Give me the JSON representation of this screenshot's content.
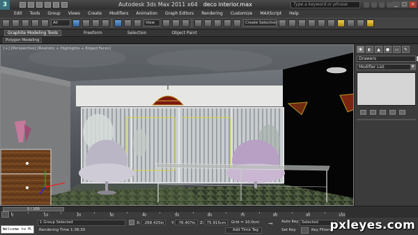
{
  "titlebar": {
    "app": "Autodesk 3ds Max  2011 x64",
    "file": "deco interior.max",
    "search_placeholder": "Type a keyword or phrase"
  },
  "menu": [
    "Edit",
    "Tools",
    "Group",
    "Views",
    "Create",
    "Modifiers",
    "Animation",
    "Graph Editors",
    "Rendering",
    "Customize",
    "MAXScript",
    "Help"
  ],
  "toolbar": {
    "filter_value": "All",
    "view_value": "View",
    "selection_set_value": "Create Selection Se"
  },
  "ribbon": {
    "tabs": [
      "Graphite Modeling Tools",
      "Freeform",
      "Selection",
      "Object Paint"
    ],
    "subtab": "Polygon Modeling"
  },
  "viewport": {
    "label": "[+] [Perspective] [Realistic + Highlights + Edged Faces]"
  },
  "command_panel": {
    "object_name": "Drawers",
    "modifier_list": "Modifier List"
  },
  "timeline": {
    "slider_label": "0 / 100",
    "ticks": [
      "0",
      "10",
      "20",
      "30",
      "40",
      "50",
      "60",
      "70",
      "80",
      "90",
      "100"
    ]
  },
  "status": {
    "maxscript_text": "Welcome to M.",
    "selection": "1 Group Selected",
    "render_time": "Rendering Time  1:38:30",
    "x_label": "X:",
    "x_value": "-268.425in",
    "y_label": "Y:",
    "y_value": "-76.407in",
    "z_label": "Z:",
    "z_value": "75.915cm",
    "grid": "Grid = 10.0cm",
    "add_time_tag": "Add Time Tag",
    "auto_key": "Auto Key",
    "set_key": "Set Key",
    "selected_dd": "Selected",
    "key_filters": "Key Filters..."
  },
  "watermark": "pxleyes.com",
  "colors": {
    "wall_dark": "#0a0a0a",
    "floor": "#3f4a3a",
    "chair": "#b9b4c4",
    "lamp": "#7a1a0e"
  }
}
